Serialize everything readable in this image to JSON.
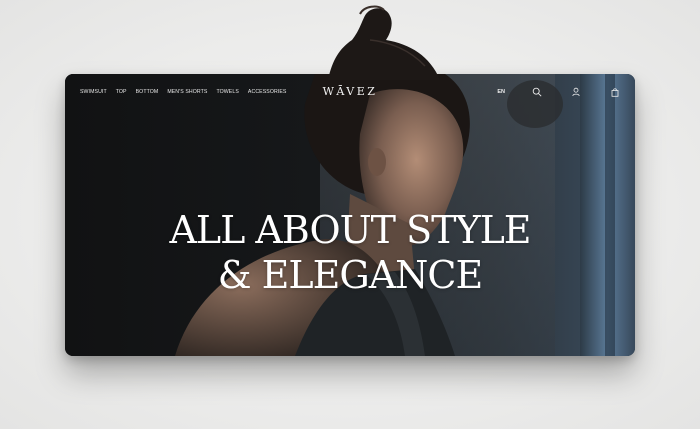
{
  "nav": {
    "links": [
      "SWIMSUIT",
      "TOP",
      "BOTTOM",
      "MEN'S SHORTS",
      "TOWELS",
      "ACCESSORIES"
    ],
    "brand": "WĀVEZ",
    "language": "EN",
    "icons": [
      "search-icon",
      "user-icon",
      "bag-icon"
    ]
  },
  "hero": {
    "headline_line1": "ALL ABOUT STYLE",
    "headline_line2": "& ELEGANCE"
  },
  "colors": {
    "background": "#ececeb",
    "hero_dark": "#141414",
    "window_blue": "#4d6e8c",
    "text_light": "#ffffff"
  }
}
